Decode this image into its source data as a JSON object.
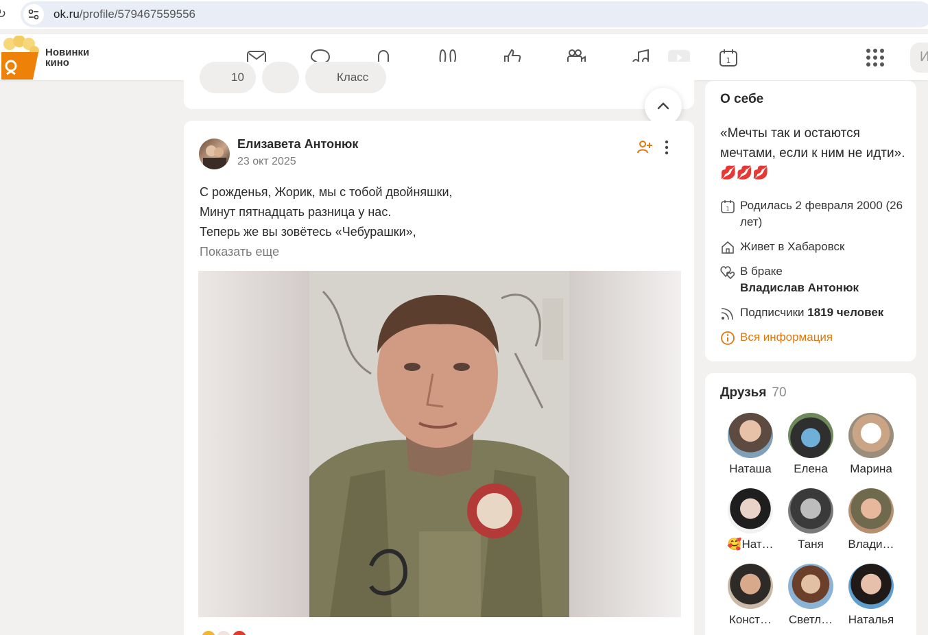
{
  "browser": {
    "url_host": "ok.ru",
    "url_path": "/profile/579467559556"
  },
  "topbar": {
    "promo_label": "Новинки кино",
    "nav_icons": [
      "mail-icon",
      "chat-icon",
      "bell-icon",
      "guests-icon",
      "like-icon",
      "video-camera-icon",
      "music-icon",
      "video-play-icon",
      "calendar-icon"
    ],
    "search_stub": "И"
  },
  "prev_post": {
    "comments_count": "10",
    "like_label": "Класс"
  },
  "post": {
    "author": "Елизавета Антонюк",
    "date": "23 окт 2025",
    "lines": [
      "С рожденья, Жорик, мы с тобой двойняшки,",
      "Минут пятнадцать разница у нас.",
      "Теперь же вы зовётесь «Чебурашки»,"
    ],
    "show_more": "Показать еще"
  },
  "about": {
    "title": "О себе",
    "quote": "«Мечты так и остаются мечтами, если к ним не идти». 💋💋💋",
    "birthday": "Родилась 2 февраля 2000 (26 лет)",
    "city": "Живет в Хабаровск",
    "marital_label": "В браке",
    "spouse": "Владислав Антонюк",
    "subscribers_label": "Подписчики",
    "subscribers_value": "1819 человек",
    "all_info": "Вся информация"
  },
  "friends": {
    "title": "Друзья",
    "count": "70",
    "items": [
      {
        "name": "Наташа"
      },
      {
        "name": "Елена"
      },
      {
        "name": "Марина"
      },
      {
        "name": "🥰Нат…"
      },
      {
        "name": "Таня"
      },
      {
        "name": "Влади…"
      },
      {
        "name": "Конст…"
      },
      {
        "name": "Светл…"
      },
      {
        "name": "Наталья"
      }
    ]
  },
  "colors": {
    "accent": "#e0770f",
    "page_bg": "#f3f1ef",
    "card_bg": "#ffffff"
  }
}
